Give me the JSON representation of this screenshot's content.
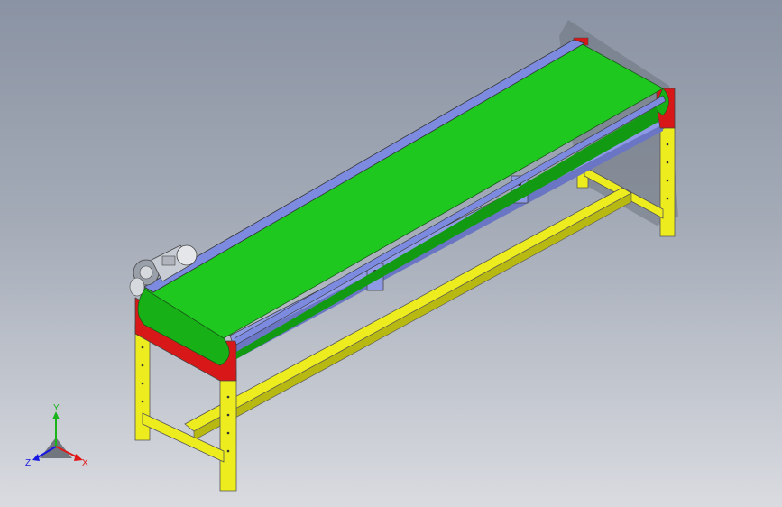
{
  "scene": {
    "subject": "belt-conveyor-3d-model",
    "colors": {
      "belt": "#1ec81e",
      "belt_dark": "#129a12",
      "side_rail": "#7c8ae0",
      "end_plate": "#d81818",
      "frame": "#ecec1e",
      "frame_dark": "#b8b812",
      "motor": "#c8ccd4"
    }
  },
  "triad": {
    "x_label": "X",
    "y_label": "Y",
    "z_label": "Z",
    "x_color": "#e01818",
    "y_color": "#18b418",
    "z_color": "#1818e0"
  }
}
